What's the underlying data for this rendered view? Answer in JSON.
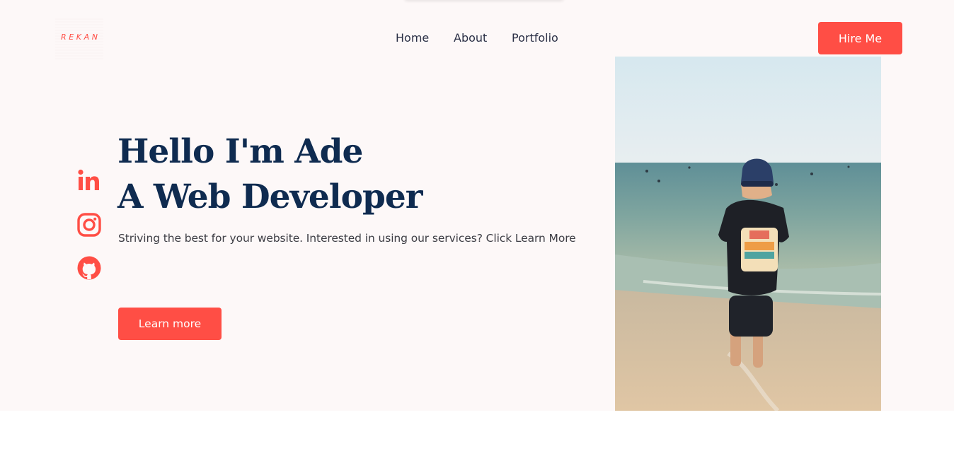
{
  "brand": {
    "logo_text": "REKAN",
    "accent_color": "#ff4e45",
    "heading_color": "#0f2b50"
  },
  "nav": {
    "items": [
      {
        "label": "Home"
      },
      {
        "label": "About"
      },
      {
        "label": "Portfolio"
      }
    ],
    "cta_label": "Hire Me"
  },
  "social": {
    "icons": [
      "linkedin-icon",
      "instagram-icon",
      "github-icon"
    ]
  },
  "hero": {
    "headline_line1": "Hello I'm Ade",
    "headline_line2": "A Web Developer",
    "subtitle": "Striving the best for your website. Interested in using our services? Click Learn More",
    "cta_label": "Learn more"
  },
  "photo": {
    "icon": "profile-photo"
  }
}
